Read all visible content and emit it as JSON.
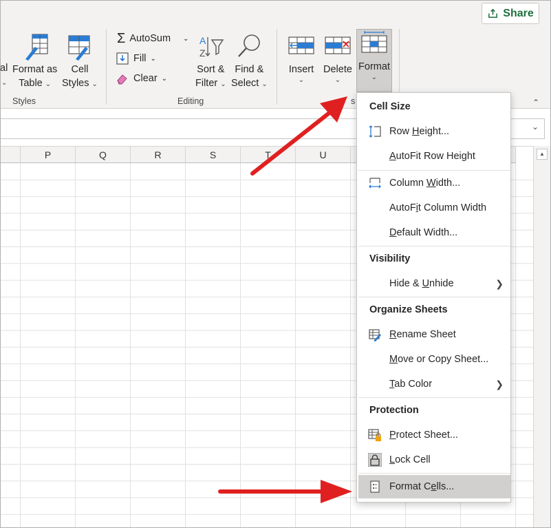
{
  "share": {
    "label": "Share"
  },
  "ribbon": {
    "partial_left": "al",
    "format_as_table": {
      "line1": "Format as",
      "line2": "Table"
    },
    "cell_styles": {
      "line1": "Cell",
      "line2": "Styles"
    },
    "styles_group": "Styles",
    "autosum": "AutoSum",
    "fill": "Fill",
    "clear": "Clear",
    "sort_filter": {
      "line1": "Sort &",
      "line2": "Filter"
    },
    "find_select": {
      "line1": "Find &",
      "line2": "Select"
    },
    "editing_group": "Editing",
    "insert": "Insert",
    "delete": "Delete",
    "format": "Format",
    "cells_group_partial": "s"
  },
  "grid": {
    "columns": [
      "",
      "P",
      "Q",
      "R",
      "S",
      "T",
      "U",
      "",
      "",
      ""
    ]
  },
  "menu": {
    "cell_size_header": "Cell Size",
    "row_height": {
      "pre": "Row ",
      "u": "H",
      "post": "eight..."
    },
    "autofit_row_height": {
      "pre": "",
      "u": "A",
      "post": "utoFit Row Height"
    },
    "column_width": {
      "pre": "Column ",
      "u": "W",
      "post": "idth..."
    },
    "autofit_column_width": {
      "pre": "AutoF",
      "u": "i",
      "post": "t Column Width"
    },
    "default_width": {
      "pre": "",
      "u": "D",
      "post": "efault Width..."
    },
    "visibility_header": "Visibility",
    "hide_unhide": {
      "pre": "Hide & ",
      "u": "U",
      "post": "nhide"
    },
    "organize_header": "Organize Sheets",
    "rename_sheet": {
      "pre": "",
      "u": "R",
      "post": "ename Sheet"
    },
    "move_copy": {
      "pre": "",
      "u": "M",
      "post": "ove or Copy Sheet..."
    },
    "tab_color": {
      "pre": "",
      "u": "T",
      "post": "ab Color"
    },
    "protection_header": "Protection",
    "protect_sheet": {
      "pre": "",
      "u": "P",
      "post": "rotect Sheet..."
    },
    "lock_cell": {
      "pre": "",
      "u": "L",
      "post": "ock Cell"
    },
    "format_cells": {
      "pre": "Format C",
      "u": "e",
      "post": "lls..."
    }
  },
  "colors": {
    "excel_green": "#1e6e3e",
    "icon_blue": "#2b7cd3",
    "arrow_red": "#e02020",
    "highlight_gray": "#d2d0ce"
  }
}
